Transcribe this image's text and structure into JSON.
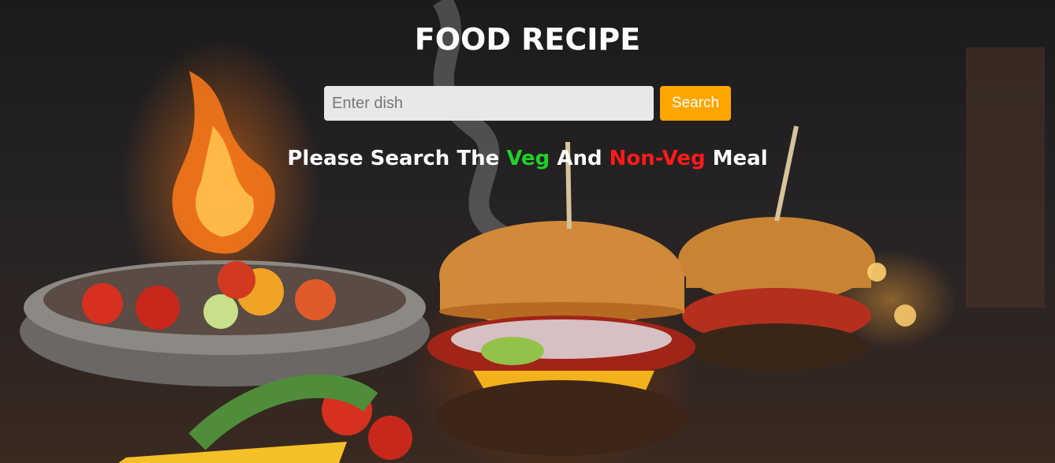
{
  "page": {
    "title": "FOOD RECIPE"
  },
  "search": {
    "placeholder": "Enter dish",
    "value": "",
    "button_label": "Search"
  },
  "tagline": {
    "part1": "Please Search The ",
    "veg": "Veg",
    "part2": " And ",
    "nonveg": "Non-Veg",
    "part3": " Meal"
  },
  "colors": {
    "accent": "#ffa500",
    "veg": "#1fd12a",
    "nonveg": "#ff1a1a"
  },
  "background": {
    "icon": "burger-background-image"
  }
}
